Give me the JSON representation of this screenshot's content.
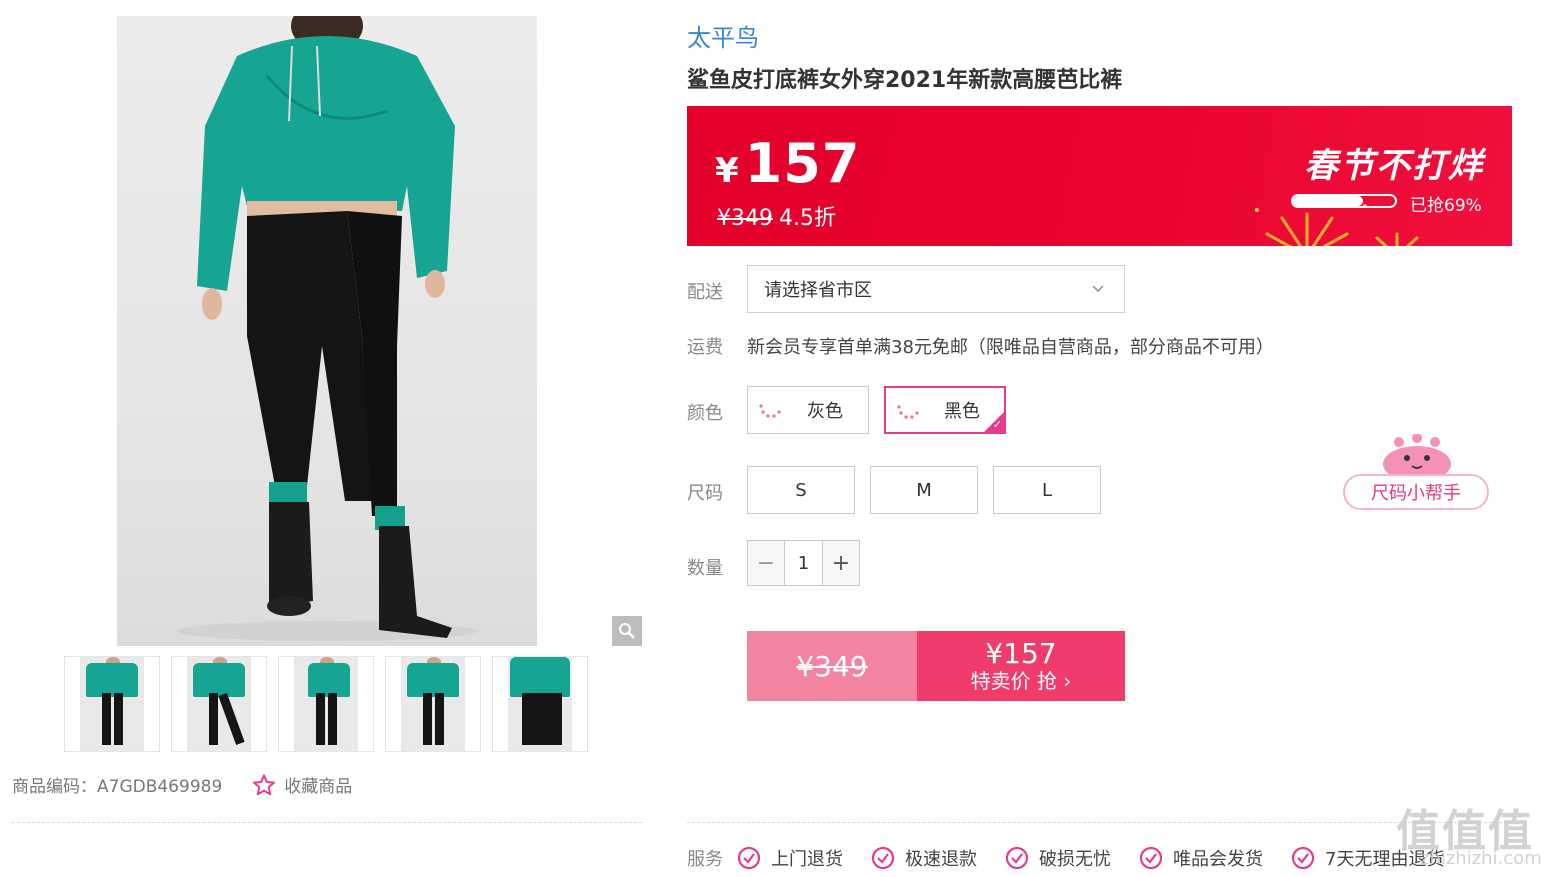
{
  "brand": "太平鸟",
  "product_title": "鲨鱼皮打底裤女外穿2021年新款高腰芭比裤",
  "price_banner": {
    "currency": "¥",
    "price": "157",
    "original_price": "¥349",
    "discount": "4.5折",
    "promo_title": "春节不打烊",
    "sold_percent": 69,
    "sold_text": "已抢69%"
  },
  "delivery": {
    "label": "配送",
    "placeholder": "请选择省市区"
  },
  "shipping": {
    "label": "运费",
    "text": "新会员专享首单满38元免邮（限唯品自营商品，部分商品不可用）"
  },
  "color": {
    "label": "颜色",
    "options": [
      "灰色",
      "黑色"
    ],
    "selected": "黑色"
  },
  "size": {
    "label": "尺码",
    "options": [
      "S",
      "M",
      "L"
    ],
    "helper": "尺码小帮手"
  },
  "quantity": {
    "label": "数量",
    "value": "1",
    "minus": "−",
    "plus": "+"
  },
  "buy": {
    "original_price": "¥349",
    "price": "¥157",
    "cta": "特卖价 抢 ›"
  },
  "sku": {
    "text": "商品编码：A7GDB469989",
    "favorite": "收藏商品"
  },
  "services": {
    "label": "服务",
    "items": [
      "上门退货",
      "极速退款",
      "破损无忧",
      "唯品会发货",
      "7天无理由退货"
    ]
  },
  "watermark": {
    "logo": "值值值",
    "site": "zhizhizhi.com"
  },
  "colors": {
    "accent_pink": "#e43c8d",
    "banner_red": "#e3002b",
    "brand_blue": "#3a86d6",
    "product_teal": "#16a592"
  }
}
